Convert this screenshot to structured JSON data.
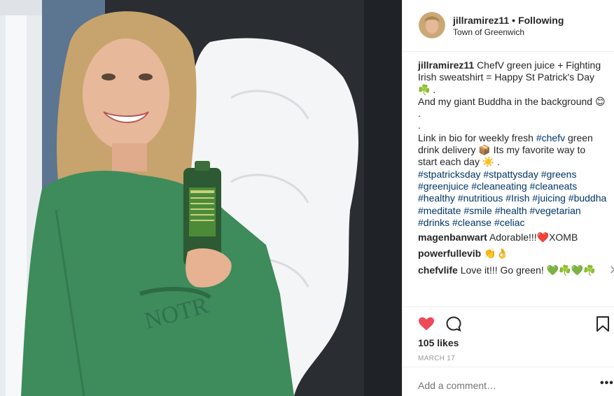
{
  "post": {
    "username": "jillramirez11",
    "follow_status": "Following",
    "location": "Town of Greenwich"
  },
  "caption": {
    "username": "jillramirez11",
    "line1": "ChefV green juice + Fighting Irish sweatshirt = Happy St Patrick's Day ☘️ .",
    "line2": "And my giant Buddha in the background 😊",
    "dot1": ".",
    "dot2": ".",
    "line3_before": "Link in bio for weekly fresh ",
    "line3_tag": "#chefv",
    "line3_after": " green drink delivery 📦 Its my favorite way to start each day ☀️ .",
    "hashtags": "#stpatricksday #stpattysday #greens #greenjuice #cleaneating #cleaneats #healthy #nutritious #Irish #juicing #buddha #meditate #smile #health #vegetarian #drinks #cleanse #celiac"
  },
  "comments": [
    {
      "username": "magenbanwart",
      "text": "Adorable!!!❤️XOMB"
    },
    {
      "username": "powerfullevib",
      "text": "👏👌"
    },
    {
      "username": "chefvlife",
      "text": "Love it!!! Go green! 💚☘️💚☘️"
    }
  ],
  "likes": "105 likes",
  "date": "MARCH 17",
  "add_comment_placeholder": "Add a comment…",
  "more_label": "•••",
  "icons": {
    "like": "heart-icon",
    "comment": "comment-icon",
    "save": "bookmark-icon",
    "remove": "close-icon"
  },
  "colors": {
    "like": "#ed4956",
    "hashtag": "#003569",
    "muted": "#999999"
  }
}
